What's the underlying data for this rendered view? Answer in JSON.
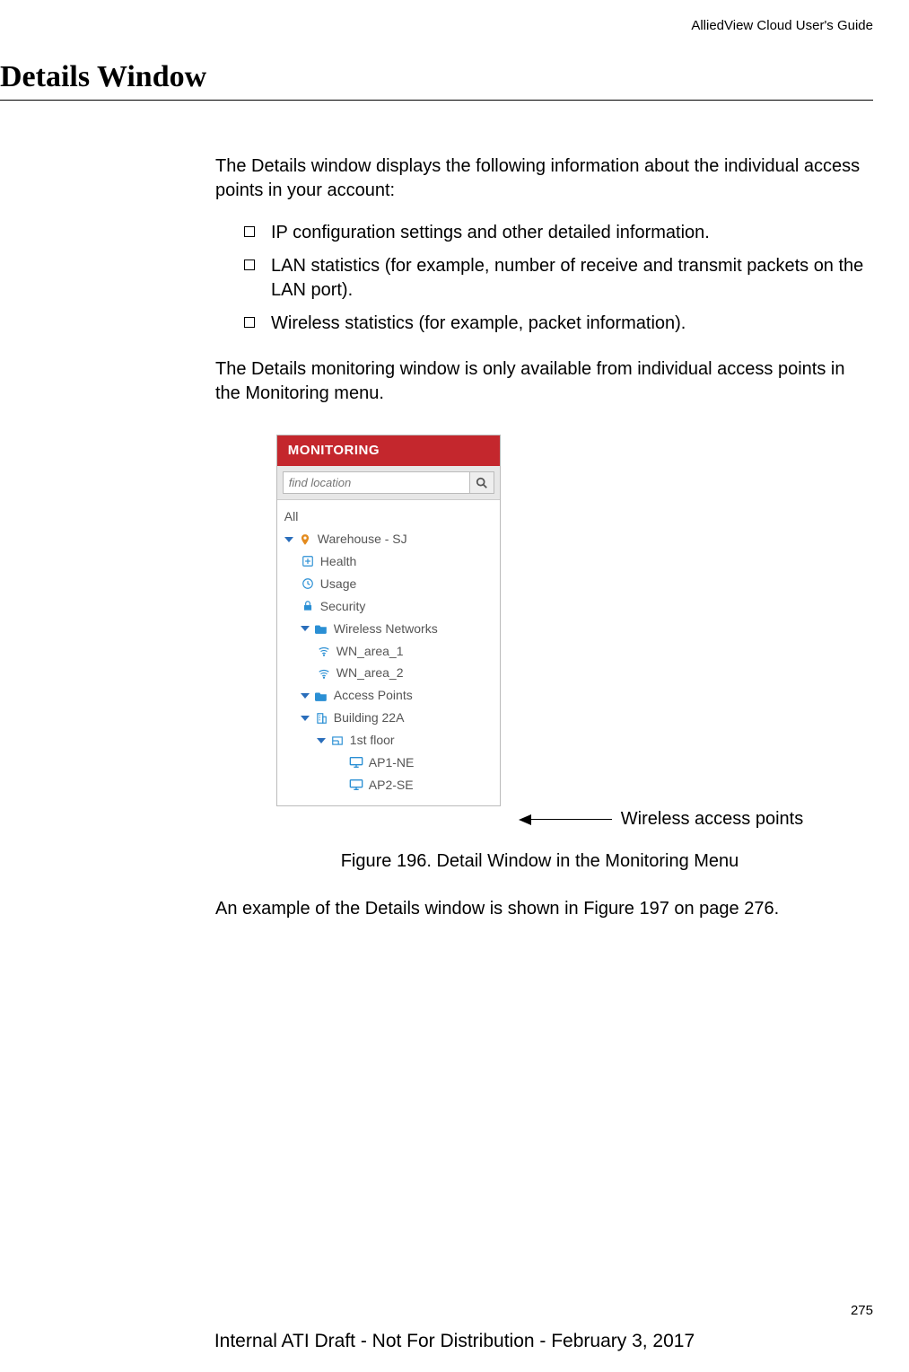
{
  "header": {
    "guide_title": "AlliedView Cloud User's Guide"
  },
  "section": {
    "title": "Details Window",
    "intro": "The Details window displays the following information about the individual access points in your account:",
    "bullets": [
      "IP configuration settings and other detailed information.",
      "LAN statistics (for example, number of receive and transmit packets on the LAN port).",
      "Wireless statistics (for example, packet information)."
    ],
    "para2": "The Details monitoring window is only available from individual access points in the Monitoring menu.",
    "para3": "An example of the Details window is shown in Figure 197 on page 276."
  },
  "monitoring_panel": {
    "header": "MONITORING",
    "search_placeholder": "find location",
    "tree": {
      "all": "All",
      "location": "Warehouse - SJ",
      "health": "Health",
      "usage": "Usage",
      "security": "Security",
      "wireless_networks": "Wireless Networks",
      "wn1": "WN_area_1",
      "wn2": "WN_area_2",
      "access_points": "Access Points",
      "building": "Building 22A",
      "floor": "1st floor",
      "ap1": "AP1-NE",
      "ap2": "AP2-SE"
    }
  },
  "annotation": {
    "label": "Wireless access points"
  },
  "figure": {
    "caption": "Figure 196. Detail Window in the Monitoring Menu"
  },
  "footer": {
    "page": "275",
    "draft": "Internal ATI Draft - Not For Distribution - February 3, 2017"
  }
}
